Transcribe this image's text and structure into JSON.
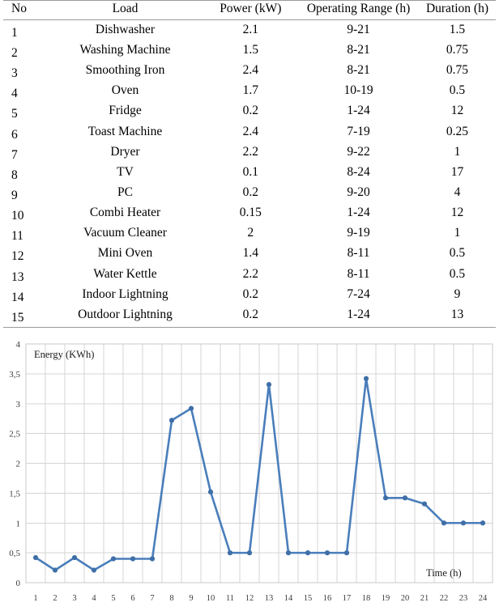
{
  "table": {
    "columns": [
      "No",
      "Load",
      "Power (kW)",
      "Operating Range (h)",
      "Duration (h)"
    ],
    "rows": [
      {
        "no": "1",
        "load": "Dishwasher",
        "power": "2.1",
        "range": "9-21",
        "duration": "1.5"
      },
      {
        "no": "2",
        "load": "Washing Machine",
        "power": "1.5",
        "range": "8-21",
        "duration": "0.75"
      },
      {
        "no": "3",
        "load": "Smoothing Iron",
        "power": "2.4",
        "range": "8-21",
        "duration": "0.75"
      },
      {
        "no": "4",
        "load": "Oven",
        "power": "1.7",
        "range": "10-19",
        "duration": "0.5"
      },
      {
        "no": "5",
        "load": "Fridge",
        "power": "0.2",
        "range": "1-24",
        "duration": "12"
      },
      {
        "no": "6",
        "load": "Toast Machine",
        "power": "2.4",
        "range": "7-19",
        "duration": "0.25"
      },
      {
        "no": "7",
        "load": "Dryer",
        "power": "2.2",
        "range": "9-22",
        "duration": "1"
      },
      {
        "no": "8",
        "load": "TV",
        "power": "0.1",
        "range": "8-24",
        "duration": "17"
      },
      {
        "no": "9",
        "load": "PC",
        "power": "0.2",
        "range": "9-20",
        "duration": "4"
      },
      {
        "no": "10",
        "load": "Combi Heater",
        "power": "0.15",
        "range": "1-24",
        "duration": "12"
      },
      {
        "no": "11",
        "load": "Vacuum Cleaner",
        "power": "2",
        "range": "9-19",
        "duration": "1"
      },
      {
        "no": "12",
        "load": "Mini Oven",
        "power": "1.4",
        "range": "8-11",
        "duration": "0.5"
      },
      {
        "no": "13",
        "load": "Water Kettle",
        "power": "2.2",
        "range": "8-11",
        "duration": "0.5"
      },
      {
        "no": "14",
        "load": "Indoor Lightning",
        "power": "0.2",
        "range": "7-24",
        "duration": "9"
      },
      {
        "no": "15",
        "load": "Outdoor Lightning",
        "power": "0.2",
        "range": "1-24",
        "duration": "13"
      }
    ]
  },
  "chart_data": {
    "type": "line",
    "title": "",
    "xlabel": "Time (h)",
    "ylabel": "Energy (KWh)",
    "xlim": [
      1,
      24
    ],
    "ylim": [
      0,
      4
    ],
    "yticks": [
      0,
      0.5,
      1,
      1.5,
      2,
      2.5,
      3,
      3.5,
      4
    ],
    "ytick_labels": [
      "0",
      "0,5",
      "1",
      "1,5",
      "2",
      "2,5",
      "3",
      "3,5",
      "4"
    ],
    "x": [
      1,
      2,
      3,
      4,
      5,
      6,
      7,
      8,
      9,
      10,
      11,
      12,
      13,
      14,
      15,
      16,
      17,
      18,
      19,
      20,
      21,
      22,
      23,
      24
    ],
    "xtick_labels": [
      "1",
      "2",
      "3",
      "4",
      "5",
      "6",
      "7",
      "8",
      "9",
      "10",
      "11",
      "12",
      "13",
      "14",
      "15",
      "16",
      "17",
      "18",
      "19",
      "20",
      "21",
      "22",
      "23",
      "24"
    ],
    "values": [
      0.42,
      0.21,
      0.42,
      0.21,
      0.4,
      0.4,
      0.4,
      2.72,
      2.92,
      1.52,
      0.5,
      0.5,
      3.32,
      0.5,
      0.5,
      0.5,
      0.5,
      3.42,
      1.42,
      1.42,
      1.32,
      1.0,
      1.0,
      1.0
    ],
    "line_color": "#4a7ebb",
    "marker_color": "#3f6fa8",
    "grid": true,
    "legend": false
  }
}
